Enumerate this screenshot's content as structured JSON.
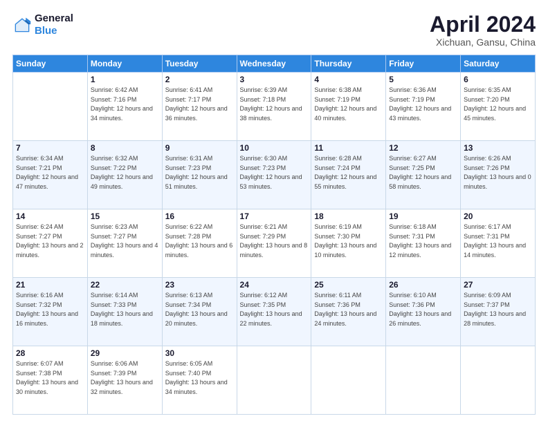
{
  "header": {
    "logo_line1": "General",
    "logo_line2": "Blue",
    "title": "April 2024",
    "location": "Xichuan, Gansu, China"
  },
  "weekdays": [
    "Sunday",
    "Monday",
    "Tuesday",
    "Wednesday",
    "Thursday",
    "Friday",
    "Saturday"
  ],
  "weeks": [
    [
      {
        "day": "",
        "sunrise": "",
        "sunset": "",
        "daylight": ""
      },
      {
        "day": "1",
        "sunrise": "Sunrise: 6:42 AM",
        "sunset": "Sunset: 7:16 PM",
        "daylight": "Daylight: 12 hours and 34 minutes."
      },
      {
        "day": "2",
        "sunrise": "Sunrise: 6:41 AM",
        "sunset": "Sunset: 7:17 PM",
        "daylight": "Daylight: 12 hours and 36 minutes."
      },
      {
        "day": "3",
        "sunrise": "Sunrise: 6:39 AM",
        "sunset": "Sunset: 7:18 PM",
        "daylight": "Daylight: 12 hours and 38 minutes."
      },
      {
        "day": "4",
        "sunrise": "Sunrise: 6:38 AM",
        "sunset": "Sunset: 7:19 PM",
        "daylight": "Daylight: 12 hours and 40 minutes."
      },
      {
        "day": "5",
        "sunrise": "Sunrise: 6:36 AM",
        "sunset": "Sunset: 7:19 PM",
        "daylight": "Daylight: 12 hours and 43 minutes."
      },
      {
        "day": "6",
        "sunrise": "Sunrise: 6:35 AM",
        "sunset": "Sunset: 7:20 PM",
        "daylight": "Daylight: 12 hours and 45 minutes."
      }
    ],
    [
      {
        "day": "7",
        "sunrise": "Sunrise: 6:34 AM",
        "sunset": "Sunset: 7:21 PM",
        "daylight": "Daylight: 12 hours and 47 minutes."
      },
      {
        "day": "8",
        "sunrise": "Sunrise: 6:32 AM",
        "sunset": "Sunset: 7:22 PM",
        "daylight": "Daylight: 12 hours and 49 minutes."
      },
      {
        "day": "9",
        "sunrise": "Sunrise: 6:31 AM",
        "sunset": "Sunset: 7:23 PM",
        "daylight": "Daylight: 12 hours and 51 minutes."
      },
      {
        "day": "10",
        "sunrise": "Sunrise: 6:30 AM",
        "sunset": "Sunset: 7:23 PM",
        "daylight": "Daylight: 12 hours and 53 minutes."
      },
      {
        "day": "11",
        "sunrise": "Sunrise: 6:28 AM",
        "sunset": "Sunset: 7:24 PM",
        "daylight": "Daylight: 12 hours and 55 minutes."
      },
      {
        "day": "12",
        "sunrise": "Sunrise: 6:27 AM",
        "sunset": "Sunset: 7:25 PM",
        "daylight": "Daylight: 12 hours and 58 minutes."
      },
      {
        "day": "13",
        "sunrise": "Sunrise: 6:26 AM",
        "sunset": "Sunset: 7:26 PM",
        "daylight": "Daylight: 13 hours and 0 minutes."
      }
    ],
    [
      {
        "day": "14",
        "sunrise": "Sunrise: 6:24 AM",
        "sunset": "Sunset: 7:27 PM",
        "daylight": "Daylight: 13 hours and 2 minutes."
      },
      {
        "day": "15",
        "sunrise": "Sunrise: 6:23 AM",
        "sunset": "Sunset: 7:27 PM",
        "daylight": "Daylight: 13 hours and 4 minutes."
      },
      {
        "day": "16",
        "sunrise": "Sunrise: 6:22 AM",
        "sunset": "Sunset: 7:28 PM",
        "daylight": "Daylight: 13 hours and 6 minutes."
      },
      {
        "day": "17",
        "sunrise": "Sunrise: 6:21 AM",
        "sunset": "Sunset: 7:29 PM",
        "daylight": "Daylight: 13 hours and 8 minutes."
      },
      {
        "day": "18",
        "sunrise": "Sunrise: 6:19 AM",
        "sunset": "Sunset: 7:30 PM",
        "daylight": "Daylight: 13 hours and 10 minutes."
      },
      {
        "day": "19",
        "sunrise": "Sunrise: 6:18 AM",
        "sunset": "Sunset: 7:31 PM",
        "daylight": "Daylight: 13 hours and 12 minutes."
      },
      {
        "day": "20",
        "sunrise": "Sunrise: 6:17 AM",
        "sunset": "Sunset: 7:31 PM",
        "daylight": "Daylight: 13 hours and 14 minutes."
      }
    ],
    [
      {
        "day": "21",
        "sunrise": "Sunrise: 6:16 AM",
        "sunset": "Sunset: 7:32 PM",
        "daylight": "Daylight: 13 hours and 16 minutes."
      },
      {
        "day": "22",
        "sunrise": "Sunrise: 6:14 AM",
        "sunset": "Sunset: 7:33 PM",
        "daylight": "Daylight: 13 hours and 18 minutes."
      },
      {
        "day": "23",
        "sunrise": "Sunrise: 6:13 AM",
        "sunset": "Sunset: 7:34 PM",
        "daylight": "Daylight: 13 hours and 20 minutes."
      },
      {
        "day": "24",
        "sunrise": "Sunrise: 6:12 AM",
        "sunset": "Sunset: 7:35 PM",
        "daylight": "Daylight: 13 hours and 22 minutes."
      },
      {
        "day": "25",
        "sunrise": "Sunrise: 6:11 AM",
        "sunset": "Sunset: 7:36 PM",
        "daylight": "Daylight: 13 hours and 24 minutes."
      },
      {
        "day": "26",
        "sunrise": "Sunrise: 6:10 AM",
        "sunset": "Sunset: 7:36 PM",
        "daylight": "Daylight: 13 hours and 26 minutes."
      },
      {
        "day": "27",
        "sunrise": "Sunrise: 6:09 AM",
        "sunset": "Sunset: 7:37 PM",
        "daylight": "Daylight: 13 hours and 28 minutes."
      }
    ],
    [
      {
        "day": "28",
        "sunrise": "Sunrise: 6:07 AM",
        "sunset": "Sunset: 7:38 PM",
        "daylight": "Daylight: 13 hours and 30 minutes."
      },
      {
        "day": "29",
        "sunrise": "Sunrise: 6:06 AM",
        "sunset": "Sunset: 7:39 PM",
        "daylight": "Daylight: 13 hours and 32 minutes."
      },
      {
        "day": "30",
        "sunrise": "Sunrise: 6:05 AM",
        "sunset": "Sunset: 7:40 PM",
        "daylight": "Daylight: 13 hours and 34 minutes."
      },
      {
        "day": "",
        "sunrise": "",
        "sunset": "",
        "daylight": ""
      },
      {
        "day": "",
        "sunrise": "",
        "sunset": "",
        "daylight": ""
      },
      {
        "day": "",
        "sunrise": "",
        "sunset": "",
        "daylight": ""
      },
      {
        "day": "",
        "sunrise": "",
        "sunset": "",
        "daylight": ""
      }
    ]
  ]
}
